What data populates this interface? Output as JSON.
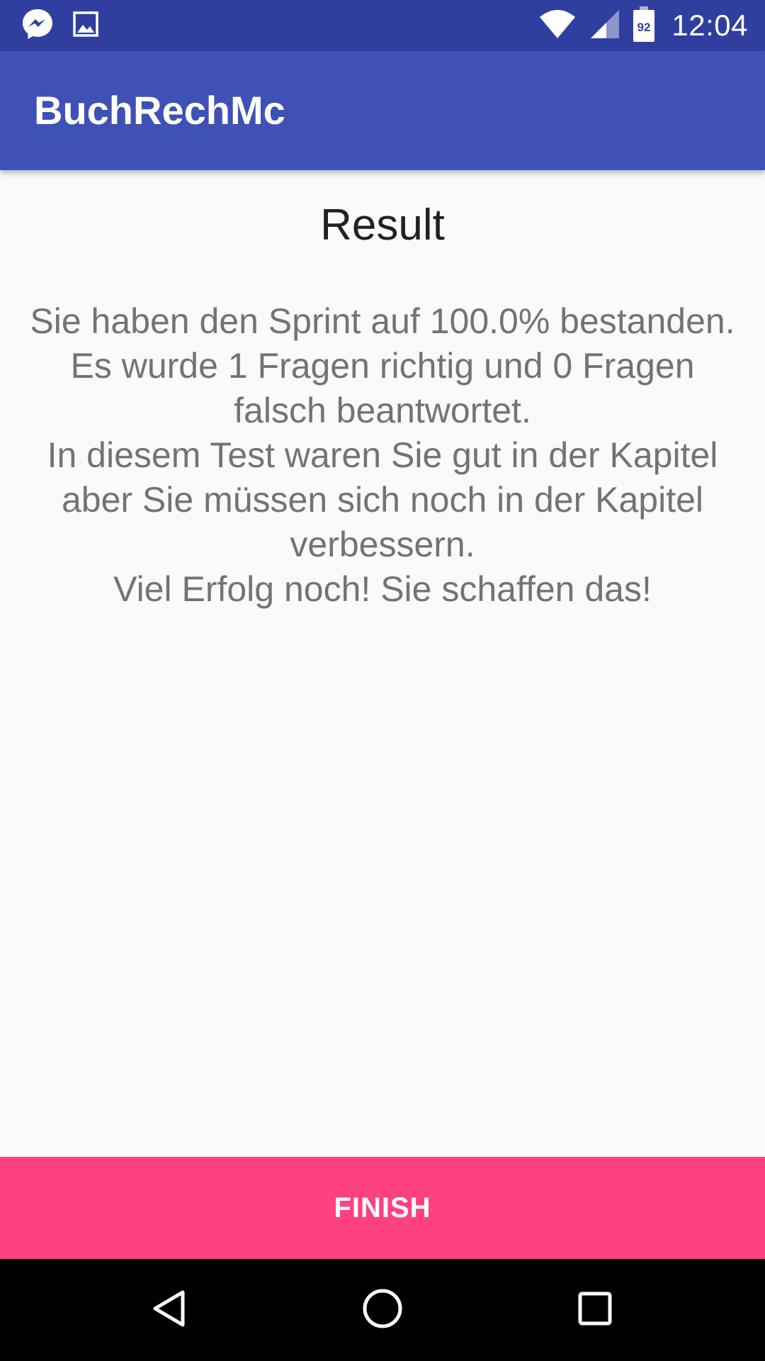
{
  "status_bar": {
    "time": "12:04",
    "battery_level": "92",
    "icons": [
      "messenger-icon",
      "image-icon",
      "wifi-icon",
      "cell-signal-icon",
      "battery-icon"
    ]
  },
  "app_bar": {
    "title": "BuchRechMc"
  },
  "result": {
    "title": "Result",
    "message": "Sie haben den Sprint auf 100.0% bestanden.\nEs wurde 1 Fragen richtig und 0 Fragen falsch beantwortet.\nIn diesem Test waren Sie gut in der Kapitel  aber Sie müssen sich noch in der Kapitel  verbessern.\nViel Erfolg noch! Sie schaffen das!"
  },
  "actions": {
    "finish_label": "FINISH"
  },
  "nav_bar": {
    "icons": [
      "back-icon",
      "home-icon",
      "recents-icon"
    ]
  },
  "colors": {
    "status_bar": "#303f9f",
    "app_bar": "#3f51b5",
    "accent": "#ff4081",
    "background": "#fafafa",
    "nav_bar": "#000000"
  }
}
